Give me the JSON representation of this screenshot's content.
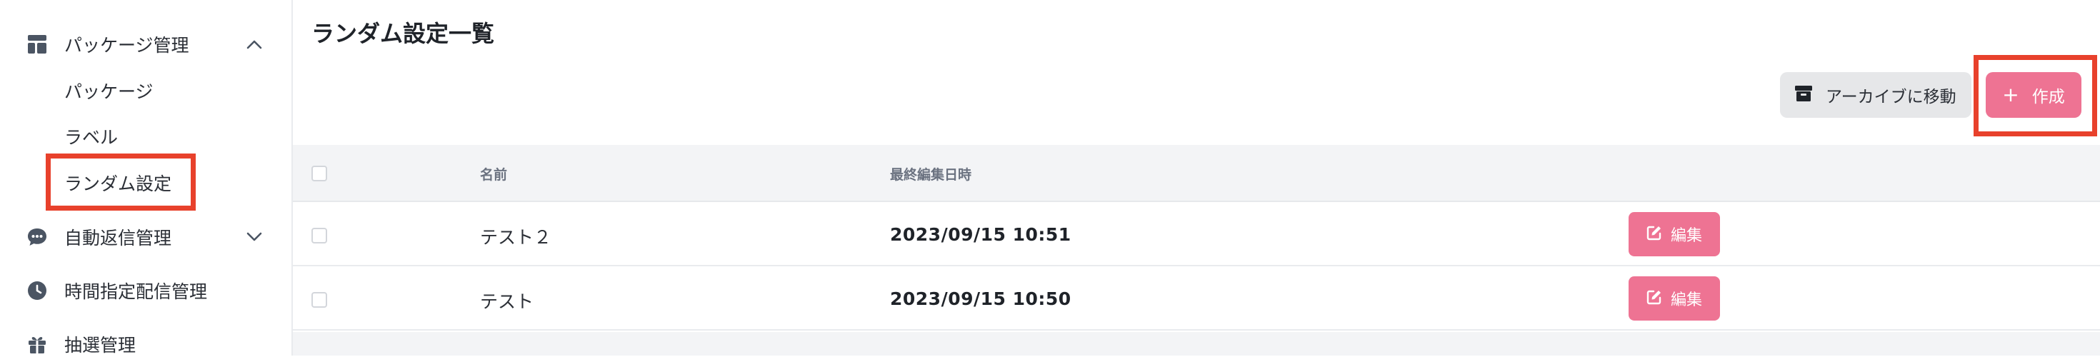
{
  "sidebar": {
    "package_mgmt": "パッケージ管理",
    "sub_items": [
      "パッケージ",
      "ラベル",
      "ランダム設定"
    ],
    "auto_reply": "自動返信管理",
    "scheduled": "時間指定配信管理",
    "lottery": "抽選管理"
  },
  "page": {
    "title": "ランダム設定一覧"
  },
  "toolbar": {
    "archive_label": "アーカイブに移動",
    "create_label": "作成",
    "create_plus": "+"
  },
  "table": {
    "headers": {
      "name": "名前",
      "updated": "最終編集日時"
    },
    "rows": [
      {
        "name": "テスト２",
        "updated": "2023/09/15 10:51",
        "edit_label": "編集"
      },
      {
        "name": "テスト",
        "updated": "2023/09/15 10:50",
        "edit_label": "編集"
      }
    ]
  },
  "colors": {
    "accent": "#ee7393",
    "highlight": "#e8412c",
    "sidebar_text": "#2b2f36"
  }
}
